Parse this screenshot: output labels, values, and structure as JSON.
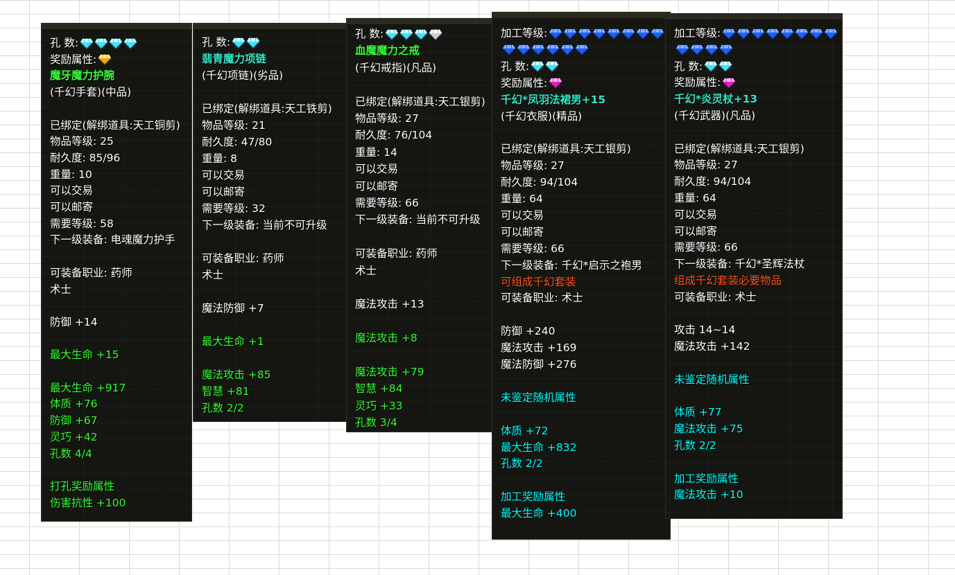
{
  "colors": {
    "panel_bg": "#151611",
    "white": "#ffffff",
    "green": "#33ff33",
    "cyan": "#00ffff",
    "orange": "#ff5522",
    "gem_cyan": "#7ff3ff",
    "gem_blue": "#2e7bff",
    "gem_gold": "#ffcc22",
    "gem_pink": "#ff3ddc"
  },
  "tooltips": [
    {
      "lines": [
        {
          "text": "孔    数:",
          "color": "white",
          "gems": [
            "cyan",
            "cyan",
            "cyan",
            "cyan"
          ]
        },
        {
          "text": "奖励属性:",
          "color": "white",
          "gems": [
            "gold"
          ]
        },
        {
          "text": "魔牙魔力护腕",
          "color": "name"
        },
        {
          "text": "(千幻手套)(中品)",
          "color": "white"
        },
        {
          "text": "",
          "color": "white"
        },
        {
          "text": "已绑定(解绑道具:天工铜剪)",
          "color": "white"
        },
        {
          "text": "物品等级: 25",
          "color": "white"
        },
        {
          "text": "耐久度: 85/96",
          "color": "white"
        },
        {
          "text": "重量: 10",
          "color": "white"
        },
        {
          "text": "可以交易",
          "color": "white"
        },
        {
          "text": "可以邮寄",
          "color": "white"
        },
        {
          "text": "需要等级: 58",
          "color": "white"
        },
        {
          "text": "下一级装备: 电魂魔力护手",
          "color": "white"
        },
        {
          "text": "",
          "color": "white"
        },
        {
          "text": "可装备职业: 药师",
          "color": "white"
        },
        {
          "text": "术士",
          "color": "white"
        },
        {
          "text": "",
          "color": "white"
        },
        {
          "text": "防御 +14",
          "color": "white"
        },
        {
          "text": "",
          "color": "white"
        },
        {
          "text": "最大生命 +15",
          "color": "green"
        },
        {
          "text": "",
          "color": "white"
        },
        {
          "text": "最大生命 +917",
          "color": "green"
        },
        {
          "text": "体质      +76",
          "color": "green"
        },
        {
          "text": "防御      +67",
          "color": "green"
        },
        {
          "text": "灵巧      +42",
          "color": "green"
        },
        {
          "text": "孔数 4/4",
          "color": "green"
        },
        {
          "text": "",
          "color": "white"
        },
        {
          "text": "打孔奖励属性",
          "color": "green"
        },
        {
          "text": "伤害抗性 +100",
          "color": "green"
        }
      ]
    },
    {
      "lines": [
        {
          "text": "孔    数:",
          "color": "white",
          "gems": [
            "cyan",
            "cyan"
          ]
        },
        {
          "text": "翡青魔力项链",
          "color": "teal"
        },
        {
          "text": "(千幻项链)(劣品)",
          "color": "white"
        },
        {
          "text": "",
          "color": "white"
        },
        {
          "text": "已绑定(解绑道具:天工铁剪)",
          "color": "white"
        },
        {
          "text": "物品等级: 21",
          "color": "white"
        },
        {
          "text": "耐久度: 47/80",
          "color": "white"
        },
        {
          "text": "重量: 8",
          "color": "white"
        },
        {
          "text": "可以交易",
          "color": "white"
        },
        {
          "text": "可以邮寄",
          "color": "white"
        },
        {
          "text": "需要等级: 32",
          "color": "white"
        },
        {
          "text": "下一级装备: 当前不可升级",
          "color": "white"
        },
        {
          "text": "",
          "color": "white"
        },
        {
          "text": "可装备职业: 药师",
          "color": "white"
        },
        {
          "text": "术士",
          "color": "white"
        },
        {
          "text": "",
          "color": "white"
        },
        {
          "text": "魔法防御 +7",
          "color": "white"
        },
        {
          "text": "",
          "color": "white"
        },
        {
          "text": "最大生命 +1",
          "color": "green"
        },
        {
          "text": "",
          "color": "white"
        },
        {
          "text": "魔法攻击 +85",
          "color": "green"
        },
        {
          "text": "智慧      +81",
          "color": "green"
        },
        {
          "text": "孔数 2/2",
          "color": "green"
        }
      ]
    },
    {
      "lines": [
        {
          "text": "孔    数:",
          "color": "white",
          "gems": [
            "cyan",
            "cyan",
            "cyan",
            "white"
          ]
        },
        {
          "text": "血魔魔力之戒",
          "color": "name"
        },
        {
          "text": "(千幻戒指)(凡品)",
          "color": "white"
        },
        {
          "text": "",
          "color": "white"
        },
        {
          "text": "已绑定(解绑道具:天工银剪)",
          "color": "white"
        },
        {
          "text": "物品等级: 27",
          "color": "white"
        },
        {
          "text": "耐久度: 76/104",
          "color": "white"
        },
        {
          "text": "重量: 14",
          "color": "white"
        },
        {
          "text": "可以交易",
          "color": "white"
        },
        {
          "text": "可以邮寄",
          "color": "white"
        },
        {
          "text": "需要等级: 66",
          "color": "white"
        },
        {
          "text": "下一级装备: 当前不可升级",
          "color": "white"
        },
        {
          "text": "",
          "color": "white"
        },
        {
          "text": "可装备职业: 药师",
          "color": "white"
        },
        {
          "text": "术士",
          "color": "white"
        },
        {
          "text": "",
          "color": "white"
        },
        {
          "text": "魔法攻击 +13",
          "color": "white"
        },
        {
          "text": "",
          "color": "white"
        },
        {
          "text": "魔法攻击 +8",
          "color": "green"
        },
        {
          "text": "",
          "color": "white"
        },
        {
          "text": "魔法攻击 +79",
          "color": "green"
        },
        {
          "text": "智慧      +84",
          "color": "green"
        },
        {
          "text": "灵巧      +33",
          "color": "green"
        },
        {
          "text": "孔数 3/4",
          "color": "green"
        }
      ]
    },
    {
      "lines": [
        {
          "text": "加工等级:",
          "color": "white",
          "gems": [
            "blue",
            "blue",
            "blue",
            "blue",
            "blue",
            "blue",
            "blue",
            "blue"
          ]
        },
        {
          "text": "",
          "color": "white",
          "gems": [
            "blue",
            "blue",
            "blue",
            "blue",
            "blue",
            "blue"
          ]
        },
        {
          "text": "孔    数:",
          "color": "white",
          "gems": [
            "cyan",
            "cyan"
          ]
        },
        {
          "text": "奖励属性:",
          "color": "white",
          "gems": [
            "pink"
          ]
        },
        {
          "text": "千幻*凤羽法裙男+15",
          "color": "teal"
        },
        {
          "text": "(千幻衣服)(精品)",
          "color": "white"
        },
        {
          "text": "",
          "color": "white"
        },
        {
          "text": "已绑定(解绑道具:天工银剪)",
          "color": "white"
        },
        {
          "text": "物品等级: 27",
          "color": "white"
        },
        {
          "text": "耐久度: 94/104",
          "color": "white"
        },
        {
          "text": "重量: 64",
          "color": "white"
        },
        {
          "text": "可以交易",
          "color": "white"
        },
        {
          "text": "可以邮寄",
          "color": "white"
        },
        {
          "text": "需要等级: 66",
          "color": "white"
        },
        {
          "text": "下一级装备: 千幻*启示之袍男",
          "color": "white"
        },
        {
          "text": "可组成千幻套装",
          "color": "orange"
        },
        {
          "text": "可装备职业: 术士",
          "color": "white"
        },
        {
          "text": "",
          "color": "white"
        },
        {
          "text": "防御 +240",
          "color": "white"
        },
        {
          "text": "魔法攻击 +169",
          "color": "white"
        },
        {
          "text": "魔法防御 +276",
          "color": "white"
        },
        {
          "text": "",
          "color": "white"
        },
        {
          "text": "未鉴定随机属性",
          "color": "cyan"
        },
        {
          "text": "",
          "color": "white"
        },
        {
          "text": "体质      +72",
          "color": "cyan"
        },
        {
          "text": "最大生命 +832",
          "color": "cyan"
        },
        {
          "text": "孔数 2/2",
          "color": "cyan"
        },
        {
          "text": "",
          "color": "white"
        },
        {
          "text": "加工奖励属性",
          "color": "cyan"
        },
        {
          "text": "最大生命 +400",
          "color": "cyan"
        }
      ]
    },
    {
      "lines": [
        {
          "text": "加工等级:",
          "color": "white",
          "gems": [
            "blue",
            "blue",
            "blue",
            "blue",
            "blue",
            "blue",
            "blue",
            "blue"
          ]
        },
        {
          "text": "",
          "color": "white",
          "gems": [
            "blue",
            "blue",
            "blue",
            "blue"
          ]
        },
        {
          "text": "孔    数:",
          "color": "white",
          "gems": [
            "cyan",
            "cyan"
          ]
        },
        {
          "text": "奖励属性:",
          "color": "white",
          "gems": [
            "pink"
          ]
        },
        {
          "text": "千幻*炎灵杖+13",
          "color": "teal"
        },
        {
          "text": "(千幻武器)(凡品)",
          "color": "white"
        },
        {
          "text": "",
          "color": "white"
        },
        {
          "text": "已绑定(解绑道具:天工银剪)",
          "color": "white"
        },
        {
          "text": "物品等级: 27",
          "color": "white"
        },
        {
          "text": "耐久度: 94/104",
          "color": "white"
        },
        {
          "text": "重量: 64",
          "color": "white"
        },
        {
          "text": "可以交易",
          "color": "white"
        },
        {
          "text": "可以邮寄",
          "color": "white"
        },
        {
          "text": "需要等级: 66",
          "color": "white"
        },
        {
          "text": "下一级装备: 千幻*圣辉法杖",
          "color": "white"
        },
        {
          "text": "组成千幻套装必要物品",
          "color": "orange"
        },
        {
          "text": "可装备职业: 术士",
          "color": "white"
        },
        {
          "text": "",
          "color": "white"
        },
        {
          "text": "攻击 14~14",
          "color": "white"
        },
        {
          "text": "魔法攻击 +142",
          "color": "white"
        },
        {
          "text": "",
          "color": "white"
        },
        {
          "text": "未鉴定随机属性",
          "color": "cyan"
        },
        {
          "text": "",
          "color": "white"
        },
        {
          "text": "体质      +77",
          "color": "cyan"
        },
        {
          "text": "魔法攻击 +75",
          "color": "cyan"
        },
        {
          "text": "孔数 2/2",
          "color": "cyan"
        },
        {
          "text": "",
          "color": "white"
        },
        {
          "text": "加工奖励属性",
          "color": "cyan"
        },
        {
          "text": "魔法攻击 +10",
          "color": "cyan"
        }
      ]
    }
  ]
}
